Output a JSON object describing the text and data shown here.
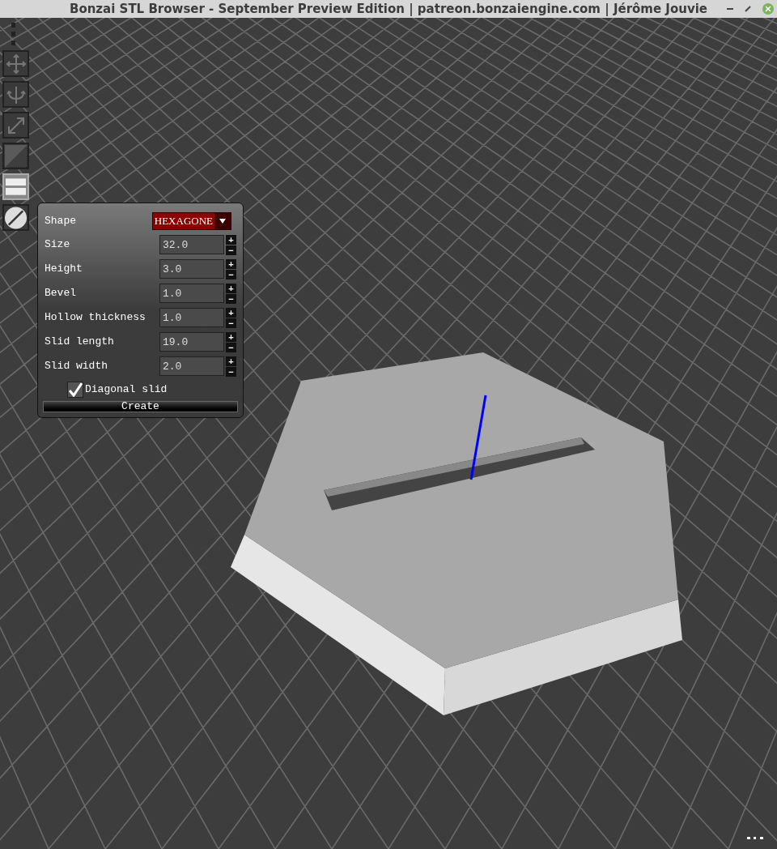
{
  "window": {
    "title": "Bonzai STL Browser - September Preview Edition | patreon.bonzaiengine.com | Jérôme Jouvie"
  },
  "tools": [
    {
      "kind": "move",
      "selected": false
    },
    {
      "kind": "rotate",
      "selected": false
    },
    {
      "kind": "scale",
      "selected": false
    },
    {
      "kind": "plane",
      "selected": false
    },
    {
      "kind": "layers",
      "selected": true
    },
    {
      "kind": "slash",
      "selected": false
    }
  ],
  "panel": {
    "shape": {
      "label": "Shape",
      "value": "HEXAGONE"
    },
    "fields": [
      {
        "label": "Size",
        "value": "32.0"
      },
      {
        "label": "Height",
        "value": "3.0"
      },
      {
        "label": "Bevel",
        "value": "1.0"
      },
      {
        "label": "Hollow thickness",
        "value": "1.0"
      },
      {
        "label": "Slid length",
        "value": "19.0"
      },
      {
        "label": "Slid width",
        "value": "2.0"
      }
    ],
    "checkbox": {
      "label": "Diagonal slid",
      "checked": true
    },
    "button": "Create"
  },
  "step_buttons": {
    "plus": "+",
    "minus": "−"
  }
}
